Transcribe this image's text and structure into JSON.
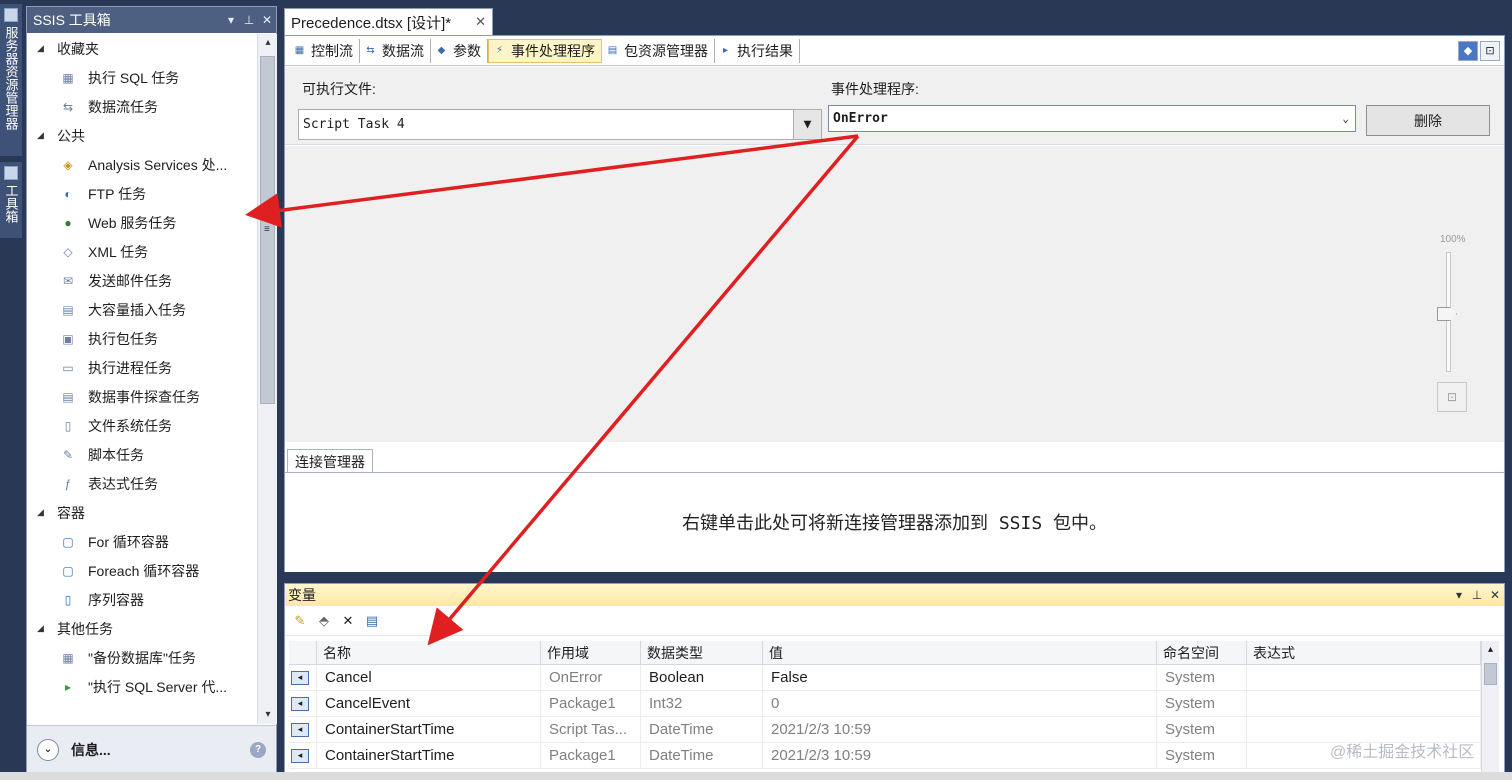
{
  "side_tabs": [
    "服务器资源管理器",
    "工具箱"
  ],
  "toolbox": {
    "title": "SSIS 工具箱",
    "categories": [
      {
        "name": "收藏夹",
        "items": [
          {
            "label": "执行 SQL 任务",
            "icon": "sql-task-icon"
          },
          {
            "label": "数据流任务",
            "icon": "dataflow-task-icon"
          }
        ]
      },
      {
        "name": "公共",
        "items": [
          {
            "label": "Analysis Services 处...",
            "icon": "analysis-services-icon"
          },
          {
            "label": "FTP 任务",
            "icon": "ftp-task-icon"
          },
          {
            "label": "Web 服务任务",
            "icon": "web-service-icon"
          },
          {
            "label": "XML 任务",
            "icon": "xml-task-icon"
          },
          {
            "label": "发送邮件任务",
            "icon": "send-mail-icon"
          },
          {
            "label": "大容量插入任务",
            "icon": "bulk-insert-icon"
          },
          {
            "label": "执行包任务",
            "icon": "execute-package-icon"
          },
          {
            "label": "执行进程任务",
            "icon": "execute-process-icon"
          },
          {
            "label": "数据事件探查任务",
            "icon": "data-profiling-icon"
          },
          {
            "label": "文件系统任务",
            "icon": "file-system-icon"
          },
          {
            "label": "脚本任务",
            "icon": "script-task-icon"
          },
          {
            "label": "表达式任务",
            "icon": "expression-task-icon"
          }
        ]
      },
      {
        "name": "容器",
        "items": [
          {
            "label": "For 循环容器",
            "icon": "for-loop-icon"
          },
          {
            "label": "Foreach 循环容器",
            "icon": "foreach-loop-icon"
          },
          {
            "label": "序列容器",
            "icon": "sequence-container-icon"
          }
        ]
      },
      {
        "name": "其他任务",
        "items": [
          {
            "label": "\"备份数据库\"任务",
            "icon": "backup-database-icon"
          },
          {
            "label": "\"执行 SQL Server 代...",
            "icon": "sql-agent-job-icon"
          }
        ]
      }
    ],
    "info_label": "信息..."
  },
  "document_tab": {
    "label": "Precedence.dtsx [设计]*"
  },
  "designer_tabs": [
    {
      "label": "控制流",
      "icon": "control-flow-icon",
      "active": false
    },
    {
      "label": "数据流",
      "icon": "data-flow-icon",
      "active": false
    },
    {
      "label": "参数",
      "icon": "parameters-icon",
      "active": false
    },
    {
      "label": "事件处理程序",
      "icon": "event-handler-icon",
      "active": true
    },
    {
      "label": "包资源管理器",
      "icon": "package-explorer-icon",
      "active": false
    },
    {
      "label": "执行结果",
      "icon": "execution-results-icon",
      "active": false
    }
  ],
  "event_handler": {
    "executable_label": "可执行文件:",
    "executable_value": "Script Task 4",
    "handler_label": "事件处理程序:",
    "handler_value": "OnError",
    "delete_label": "删除"
  },
  "zoom": {
    "label": "100%"
  },
  "connection_managers": {
    "tab_label": "连接管理器",
    "hint": "右键单击此处可将新连接管理器添加到 SSIS 包中。"
  },
  "variables": {
    "title": "变量",
    "columns": [
      "名称",
      "作用域",
      "数据类型",
      "值",
      "命名空间",
      "表达式"
    ],
    "rows": [
      {
        "name": "Cancel",
        "scope": "OnError",
        "type": "Boolean",
        "value": "False",
        "namespace": "System",
        "expression": ""
      },
      {
        "name": "CancelEvent",
        "scope": "Package1",
        "type": "Int32",
        "value": "0",
        "namespace": "System",
        "expression": ""
      },
      {
        "name": "ContainerStartTime",
        "scope": "Script Tas...",
        "type": "DateTime",
        "value": "2021/2/3 10:59",
        "namespace": "System",
        "expression": ""
      },
      {
        "name": "ContainerStartTime",
        "scope": "Package1",
        "type": "DateTime",
        "value": "2021/2/3 10:59",
        "namespace": "System",
        "expression": ""
      }
    ]
  },
  "watermark": "@稀土掘金技术社区",
  "colors": {
    "chrome": "#293955",
    "active_tab": "#fdf4c8",
    "arrow": "#e02020"
  }
}
